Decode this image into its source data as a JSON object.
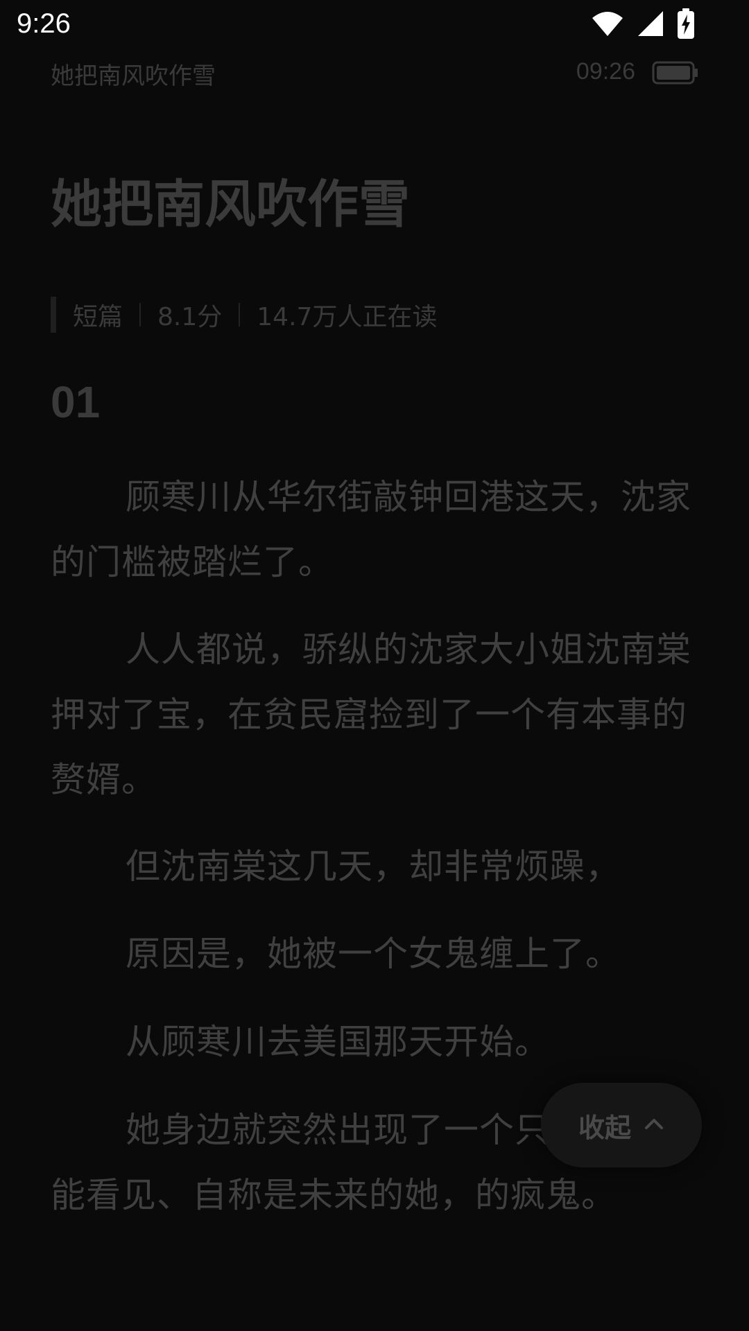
{
  "status_bar": {
    "time": "9:26",
    "icons": [
      "wifi-icon",
      "cellular-signal-icon",
      "battery-charging-icon"
    ]
  },
  "reader_header": {
    "book_title": "她把南风吹作雪",
    "time": "09:26",
    "battery_icon": "battery-icon"
  },
  "book": {
    "title": "她把南风吹作雪",
    "meta": {
      "type": "短篇",
      "score": "8.1分",
      "readers": "14.7万人正在读"
    }
  },
  "chapter": {
    "number": "01",
    "paragraphs": [
      "顾寒川从华尔街敲钟回港这天，沈家的门槛被踏烂了。",
      "人人都说，骄纵的沈家大小姐沈南棠押对了宝，在贫民窟捡到了一个有本事的赘婿。",
      "但沈南棠这几天，却非常烦躁，",
      "原因是，她被一个女鬼缠上了。",
      "从顾寒川去美国那天开始。",
      "她身边就突然出现了一个只有沈南棠能看见、自称是未来的她，的疯鬼。"
    ]
  },
  "fab": {
    "label": "收起",
    "icon": "chevron-up-icon"
  },
  "colors": {
    "background": "#0a0a0a",
    "text_dim": "#404040",
    "fab_bg": "#161616"
  }
}
